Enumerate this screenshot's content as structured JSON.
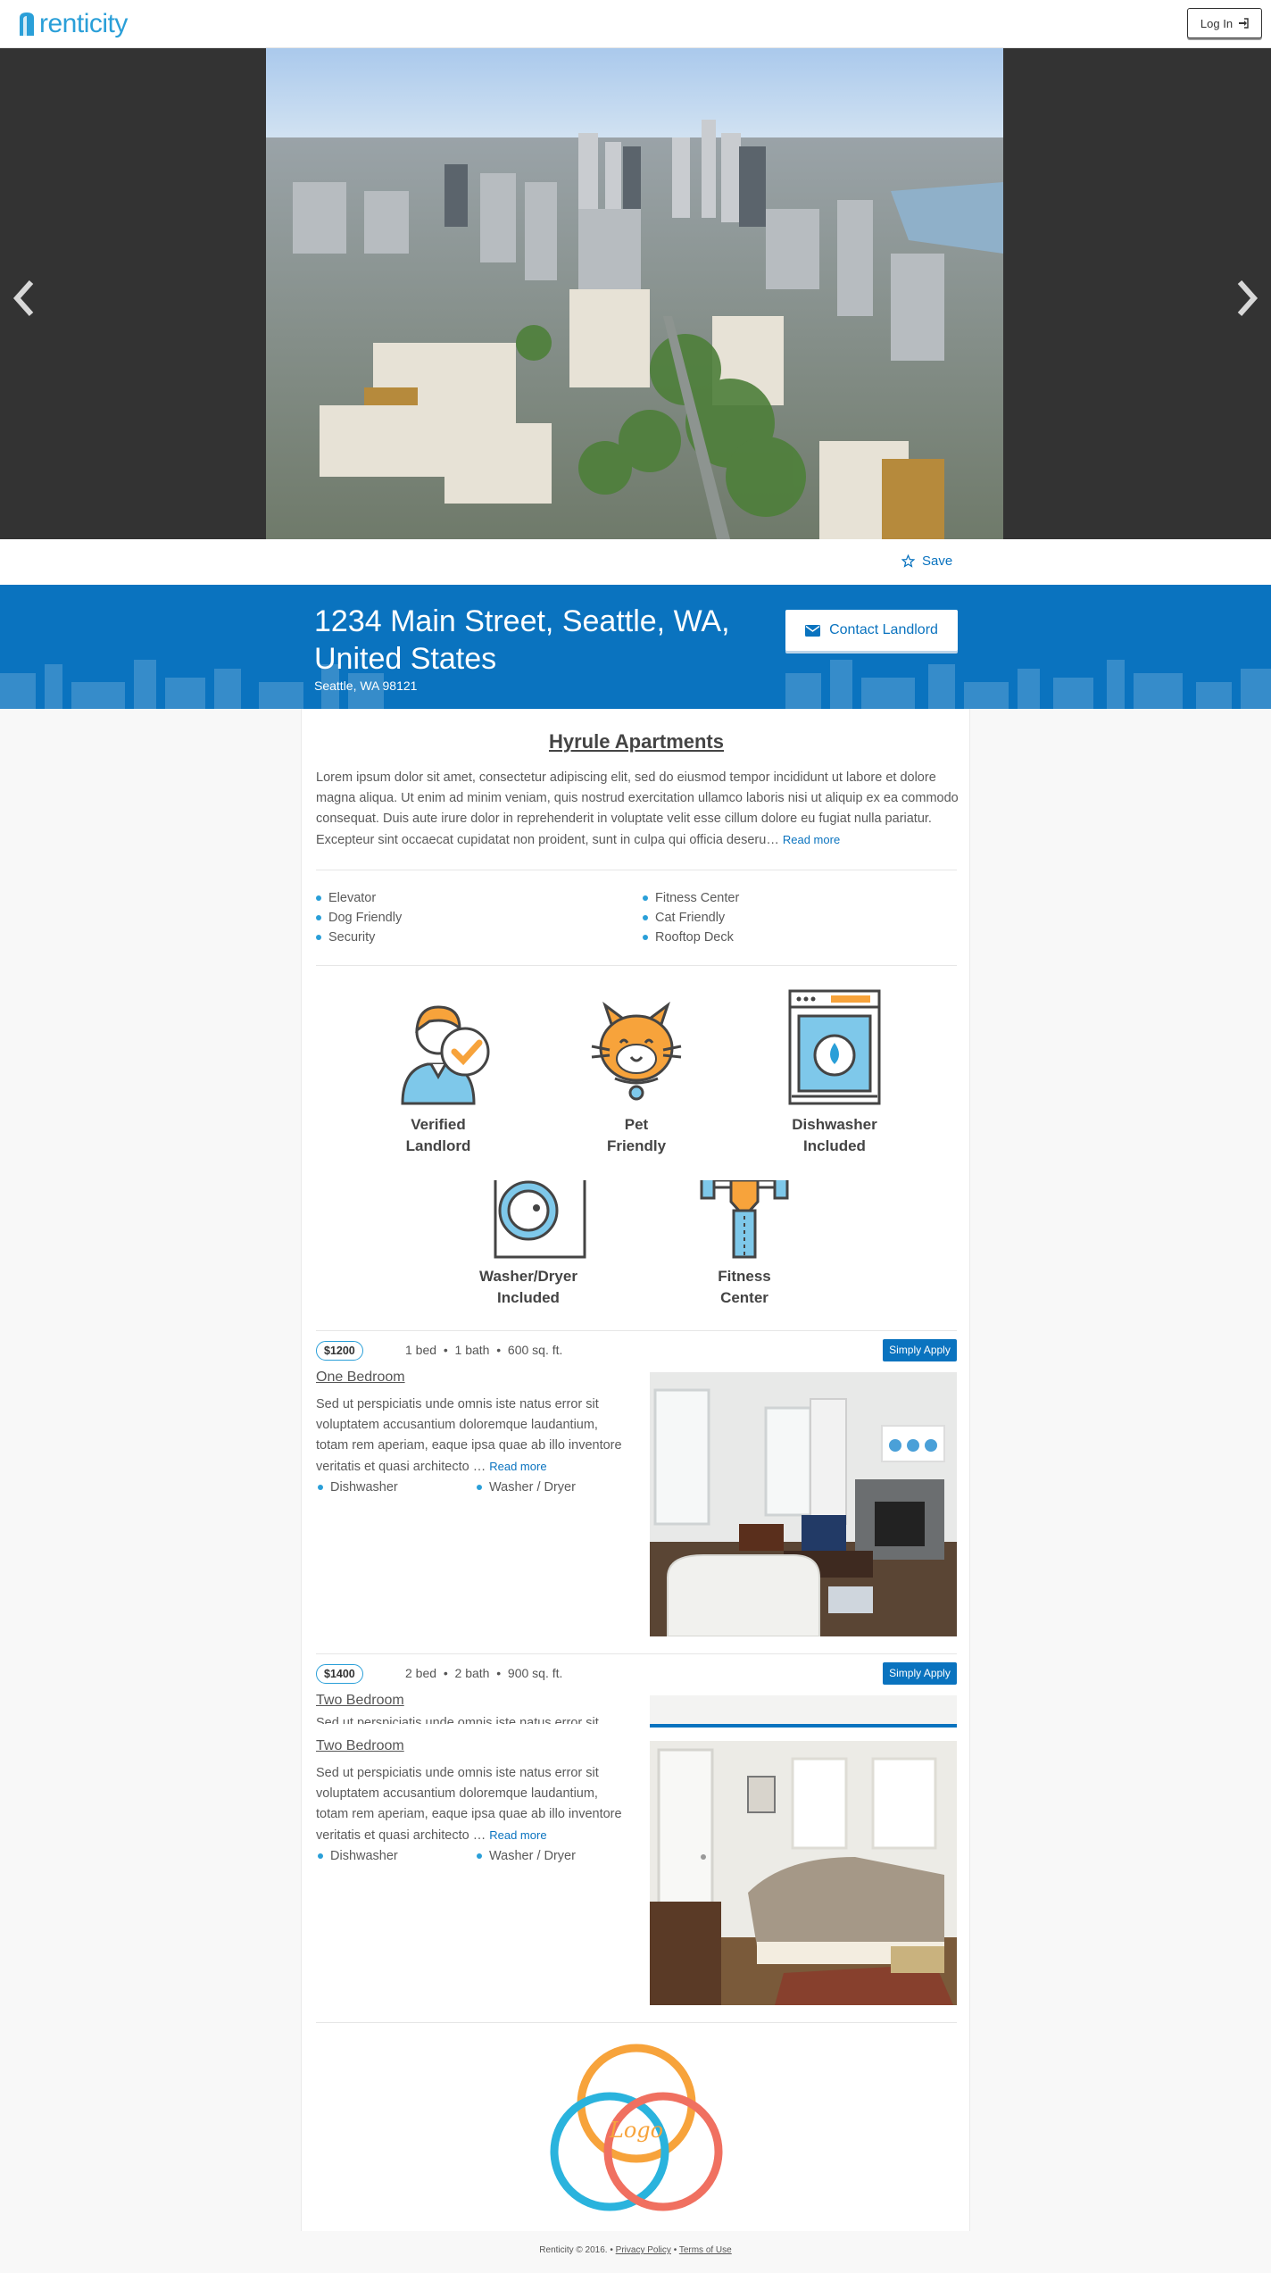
{
  "header": {
    "brand": "renticity",
    "login_label": "Log In"
  },
  "hero": {
    "save_label": "Save"
  },
  "listing": {
    "address": "1234 Main Street, Seattle, WA, United States",
    "city_zip": "Seattle, WA 98121",
    "contact_label": "Contact Landlord",
    "name": "Hyrule Apartments",
    "description": "Lorem ipsum dolor sit amet, consectetur adipiscing elit, sed do eiusmod tempor incididunt ut labore et dolore magna aliqua. Ut enim ad minim veniam, quis nostrud exercitation ullamco laboris nisi ut aliquip ex ea commodo consequat. Duis aute irure dolor in reprehenderit in voluptate velit esse cillum dolore eu fugiat nulla pariatur. Excepteur sint occaecat cupidatat non proident, sunt in culpa qui officia deseru…",
    "read_more": "Read more"
  },
  "amenities": {
    "left": [
      "Elevator",
      "Dog Friendly",
      "Security"
    ],
    "right": [
      "Fitness Center",
      "Cat Friendly",
      "Rooftop Deck"
    ]
  },
  "features": [
    {
      "line1": "Verified",
      "line2": "Landlord",
      "icon": "verified-landlord-icon"
    },
    {
      "line1": "Pet",
      "line2": "Friendly",
      "icon": "cat-icon"
    },
    {
      "line1": "Dishwasher",
      "line2": "Included",
      "icon": "dishwasher-icon"
    },
    {
      "line1": "Washer/Dryer",
      "line2": "Included",
      "icon": "washer-icon"
    },
    {
      "line1": "Fitness",
      "line2": "Center",
      "icon": "dumbbell-icon"
    }
  ],
  "units": [
    {
      "price": "$1200",
      "beds": "1 bed",
      "baths": "1 bath",
      "size": "600 sq. ft.",
      "apply_label": "Simply Apply",
      "title": "One Bedroom",
      "description": "Sed ut perspiciatis unde omnis iste natus error sit voluptatem accusantium doloremque laudantium, totam rem aperiam, eaque ipsa quae ab illo inventore veritatis et quasi architecto …",
      "read_more": "Read more",
      "amenities": [
        "Dishwasher",
        "Washer / Dryer"
      ]
    },
    {
      "price": "$1400",
      "beds": "2 bed",
      "baths": "2 bath",
      "size": "900 sq. ft.",
      "apply_label": "Simply Apply",
      "title": "Two Bedroom",
      "description": "Sed ut perspiciatis unde omnis iste natus error sit voluptatem accusantium doloremque laudantium, totam rem aperiam, eaque ipsa quae ab illo inventore veritatis et quasi architecto …",
      "read_more": "Read more",
      "amenities": [
        "Dishwasher",
        "Washer / Dryer"
      ],
      "ghost_text": "Sed ut perspiciatis unde omnis iste natus error sit"
    }
  ],
  "brand_logo_text": "Logo",
  "footer": {
    "copyright": "Renticity © 2016.",
    "sep": "•",
    "privacy": "Privacy Policy",
    "terms": "Terms of Use"
  },
  "colors": {
    "brand_blue": "#0a73bf",
    "accent_blue": "#2a9fd8",
    "accent_orange": "#f7a33b"
  }
}
